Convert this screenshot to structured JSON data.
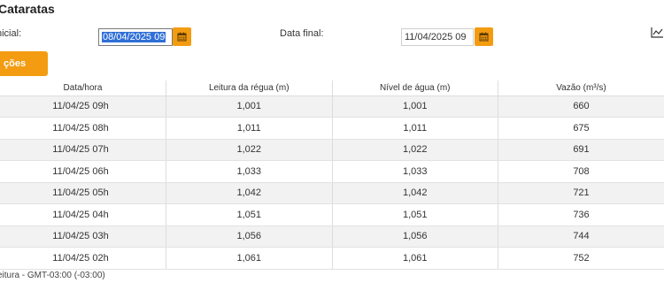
{
  "page": {
    "title": "Cataratas"
  },
  "filters": {
    "start_label": "nicial:",
    "start_value": "08/04/2025 09",
    "end_label": "Data final:",
    "end_value": "11/04/2025 09"
  },
  "icons": {
    "calendar": "calendar-icon",
    "chart": "line-chart-icon"
  },
  "actions": {
    "button_label": "ções"
  },
  "colors": {
    "accent": "#f39c12",
    "selection": "#2f6fd6",
    "row_alt": "#f2f2f2"
  },
  "table": {
    "headers": [
      "Data/hora",
      "Leitura da régua (m)",
      "Nível de água (m)",
      "Vazão (m³/s)"
    ],
    "rows": [
      [
        "11/04/25 09h",
        "1,001",
        "1,001",
        "660"
      ],
      [
        "11/04/25 08h",
        "1,011",
        "1,011",
        "675"
      ],
      [
        "11/04/25 07h",
        "1,022",
        "1,022",
        "691"
      ],
      [
        "11/04/25 06h",
        "1,033",
        "1,033",
        "708"
      ],
      [
        "11/04/25 05h",
        "1,042",
        "1,042",
        "721"
      ],
      [
        "11/04/25 04h",
        "1,051",
        "1,051",
        "736"
      ],
      [
        "11/04/25 03h",
        "1,056",
        "1,056",
        "744"
      ],
      [
        "11/04/25 02h",
        "1,061",
        "1,061",
        "752"
      ]
    ]
  },
  "footer": {
    "note": "eitura - GMT-03:00 (-03:00)"
  }
}
